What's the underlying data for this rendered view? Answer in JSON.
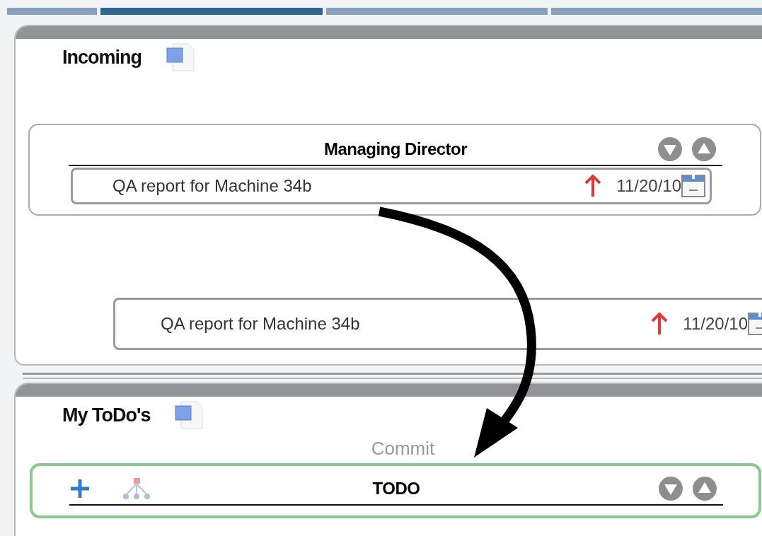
{
  "tabs": [
    {
      "selected": false
    },
    {
      "selected": true
    },
    {
      "selected": false
    },
    {
      "selected": false
    }
  ],
  "incoming": {
    "title": "Incoming",
    "groups": [
      {
        "title": "Managing Director",
        "tasks": [
          {
            "title": "QA report for Machine 34b",
            "high_priority": true,
            "due": "11/20/10"
          }
        ]
      }
    ],
    "dragged_task": {
      "title": "QA report for Machine 34b",
      "high_priority": true,
      "due": "11/20/10"
    }
  },
  "todo": {
    "title": "My ToDo's",
    "drop_hint": "Commit",
    "group": {
      "title": "TODO",
      "drop_target": true
    }
  }
}
